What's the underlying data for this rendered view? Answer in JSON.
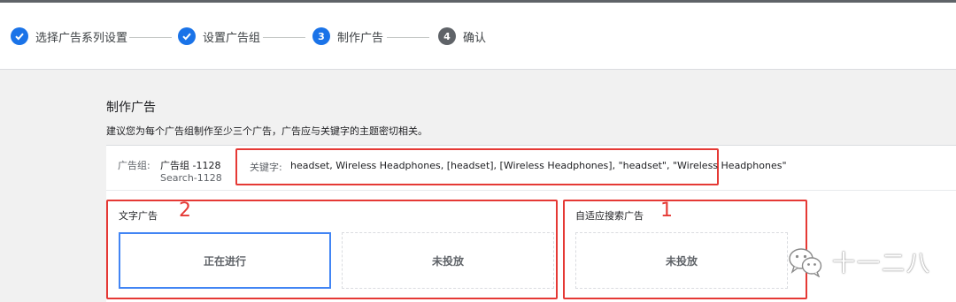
{
  "stepper": {
    "steps": [
      {
        "label": "选择广告系列设置",
        "state": "done",
        "marker": "✓"
      },
      {
        "label": "设置广告组",
        "state": "done",
        "marker": "✓"
      },
      {
        "label": "制作广告",
        "state": "active",
        "marker": "3"
      },
      {
        "label": "确认",
        "state": "todo",
        "marker": "4"
      }
    ]
  },
  "page": {
    "title": "制作广告",
    "description": "建议您为每个广告组制作至少三个广告，广告应与关键字的主题密切相关。"
  },
  "adgroup": {
    "label": "广告组:",
    "name": "广告组 -1128",
    "campaign": "Search-1128",
    "keywords_label": "关键字:",
    "keywords_value": "headset, Wireless Headphones, [headset], [Wireless Headphones], \"headset\", \"Wireless Headphones\""
  },
  "sections": {
    "text_ads": {
      "title": "文字广告",
      "annotation": "2",
      "tiles": [
        "正在进行",
        "未投放"
      ]
    },
    "responsive_search_ads": {
      "title": "自适应搜索广告",
      "annotation": "1",
      "tiles": [
        "未投放"
      ]
    }
  },
  "watermark": {
    "text": "十一二八",
    "icon": "wechat-icon"
  },
  "colors": {
    "accent": "#1a73e8",
    "annotation": "#e53935",
    "active_tile_border": "#4285f4"
  }
}
